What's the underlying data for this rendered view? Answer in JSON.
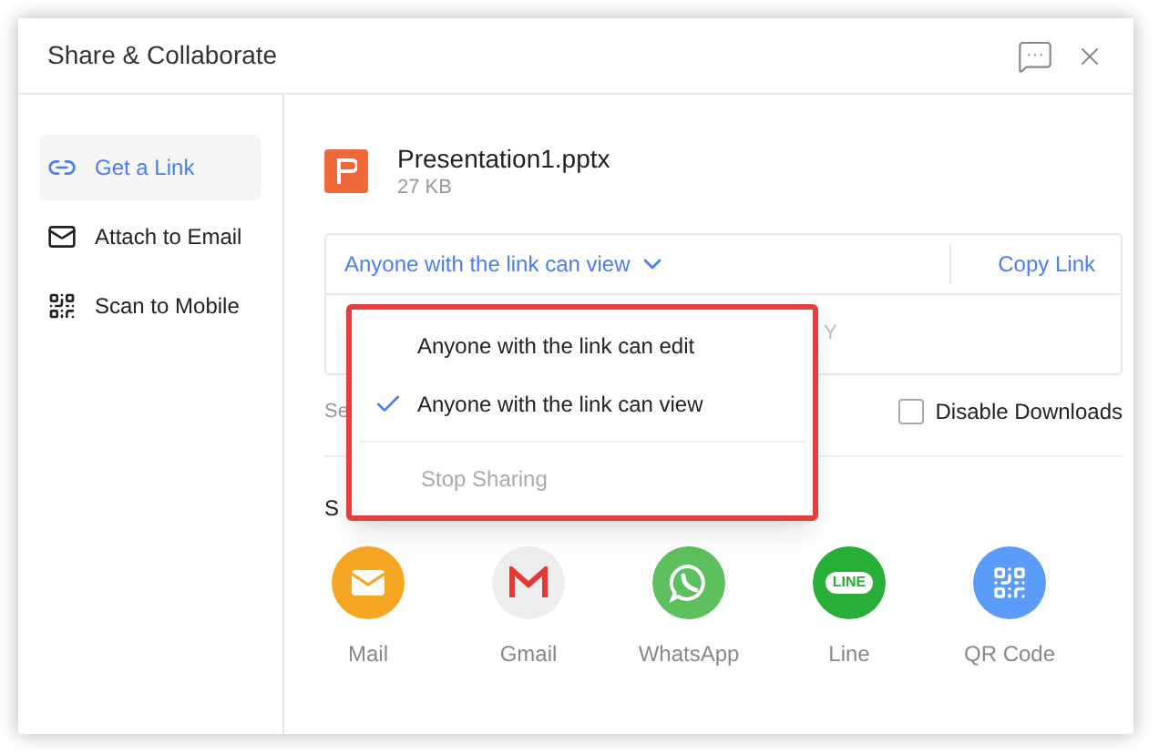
{
  "window": {
    "title": "Share & Collaborate"
  },
  "sidebar": {
    "items": [
      {
        "kind": "link",
        "label": "Get a Link",
        "selected": true
      },
      {
        "kind": "email",
        "label": "Attach to Email",
        "selected": false
      },
      {
        "kind": "qr",
        "label": "Scan to Mobile",
        "selected": false
      }
    ]
  },
  "file": {
    "name": "Presentation1.pptx",
    "size": "27 KB"
  },
  "link_box": {
    "permission": "Anyone with the link can view",
    "copy_button": "Copy Link",
    "link_fragment": "Y"
  },
  "settings_fragment": "Se",
  "disable_downloads": {
    "label": "Disable Downloads",
    "checked": false
  },
  "share_fragment": "S",
  "share_targets": [
    {
      "kind": "mail",
      "label": "Mail"
    },
    {
      "kind": "gmail",
      "label": "Gmail"
    },
    {
      "kind": "whatsapp",
      "label": "WhatsApp"
    },
    {
      "kind": "line",
      "label": "Line",
      "icon_text": "LINE"
    },
    {
      "kind": "qr",
      "label": "QR Code"
    }
  ],
  "menu": {
    "items": [
      {
        "kind": "option",
        "label": "Anyone with the link can edit",
        "selected": false
      },
      {
        "kind": "option",
        "label": "Anyone with the link can view",
        "selected": true
      },
      {
        "kind": "divider"
      },
      {
        "kind": "action",
        "label": "Stop Sharing",
        "disabled": true
      }
    ]
  }
}
